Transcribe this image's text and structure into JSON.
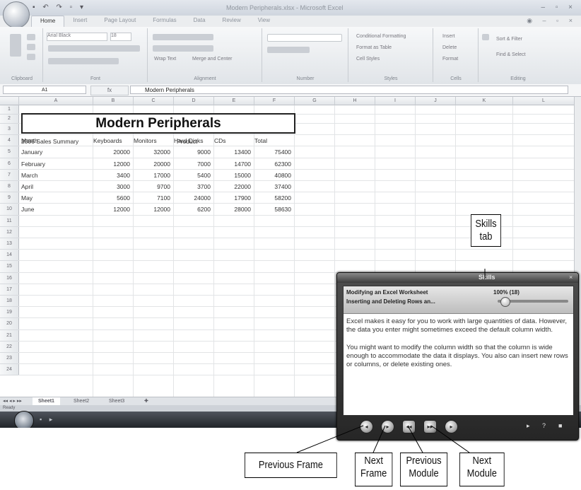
{
  "window": {
    "title": "Modern Peripherals.xlsx - Microsoft Excel",
    "tabs": [
      "Home",
      "Insert",
      "Page Layout",
      "Formulas",
      "Data",
      "Review",
      "View"
    ]
  },
  "ribbon": {
    "font_name": "Arial Black",
    "font_size": "18",
    "wrap_text": "Wrap Text",
    "merge_center": "Merge and Center",
    "cond_format": "Conditional Formatting",
    "format_table": "Format as Table",
    "cell_styles": "Cell Styles",
    "insert": "Insert",
    "delete": "Delete",
    "format": "Format",
    "sort_filter": "Sort & Filter",
    "find_select": "Find & Select",
    "groups": [
      "Clipboard",
      "Font",
      "Alignment",
      "Number",
      "Styles",
      "Cells",
      "Editing"
    ]
  },
  "formula_bar": {
    "name_box": "A1",
    "fx": "fx",
    "content": "Modern Peripherals"
  },
  "sheet": {
    "columns": [
      "A",
      "B",
      "C",
      "D",
      "E",
      "F",
      "G",
      "H",
      "I",
      "J",
      "K",
      "L"
    ],
    "rows": [
      "1",
      "2",
      "3",
      "4",
      "5",
      "6",
      "7",
      "8",
      "9",
      "10",
      "11",
      "12",
      "13",
      "14",
      "15",
      "16",
      "17",
      "18",
      "19",
      "20",
      "21",
      "22",
      "23",
      "24"
    ],
    "title": "Modern Peripherals",
    "subtitle": "2006 Sales Summary",
    "product_label": "Product",
    "headers": [
      "Month",
      "Keyboards",
      "Monitors",
      "Hard Disks",
      "CDs",
      "Total"
    ],
    "data": [
      [
        "January",
        "20000",
        "32000",
        "9000",
        "13400",
        "75400"
      ],
      [
        "February",
        "12000",
        "20000",
        "7000",
        "14700",
        "62300"
      ],
      [
        "March",
        "3400",
        "17000",
        "5400",
        "15000",
        "40800"
      ],
      [
        "April",
        "3000",
        "9700",
        "3700",
        "22000",
        "37400"
      ],
      [
        "May",
        "5600",
        "7100",
        "24000",
        "17900",
        "58200"
      ],
      [
        "June",
        "12000",
        "12000",
        "6200",
        "28000",
        "58630"
      ]
    ],
    "sheet_tabs": [
      "Sheet1",
      "Sheet2",
      "Sheet3"
    ],
    "status": "Ready"
  },
  "tutorial": {
    "window_title": "Skills",
    "module": "Modifying an Excel Worksheet",
    "progress": "100% (18)",
    "section": "Inserting and Deleting Rows an...",
    "para1": "Excel makes it easy for you to work with large quantities of data. However, the data you enter might sometimes exceed the default column width.",
    "para2": "You might want to modify the column width so that the column is wide enough to accommodate the data it displays. You also can insert new rows or columns, or delete existing ones."
  },
  "callouts": {
    "skills_tab": [
      "Skills",
      "tab"
    ],
    "previous_frame": [
      "Previous Frame"
    ],
    "next_frame": [
      "Next",
      "Frame"
    ],
    "previous_module": [
      "Previous",
      "Module"
    ],
    "next_module": [
      "Next",
      "Module"
    ]
  }
}
